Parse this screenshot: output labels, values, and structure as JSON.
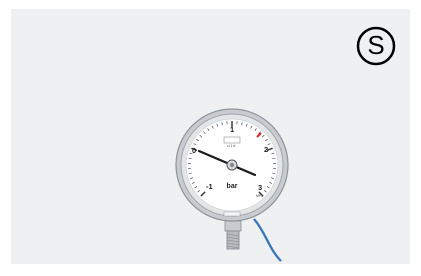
{
  "product_card": {
    "badge": {
      "icon": "s-in-circle-icon",
      "letter": "S"
    },
    "gauge": {
      "icon": "pressure-gauge-icon",
      "unit": "bar",
      "dial_labels": [
        "-1",
        "0",
        "1",
        "2",
        "3"
      ],
      "scale_secondary": "MPa",
      "marks_small": "cl 1.6",
      "colors": {
        "needle": "#1c1c1c",
        "red_marker": "#d1302b",
        "bezel": "#c8ccd1",
        "cable": "#3a77b8",
        "background": "#eef0f2"
      }
    }
  }
}
